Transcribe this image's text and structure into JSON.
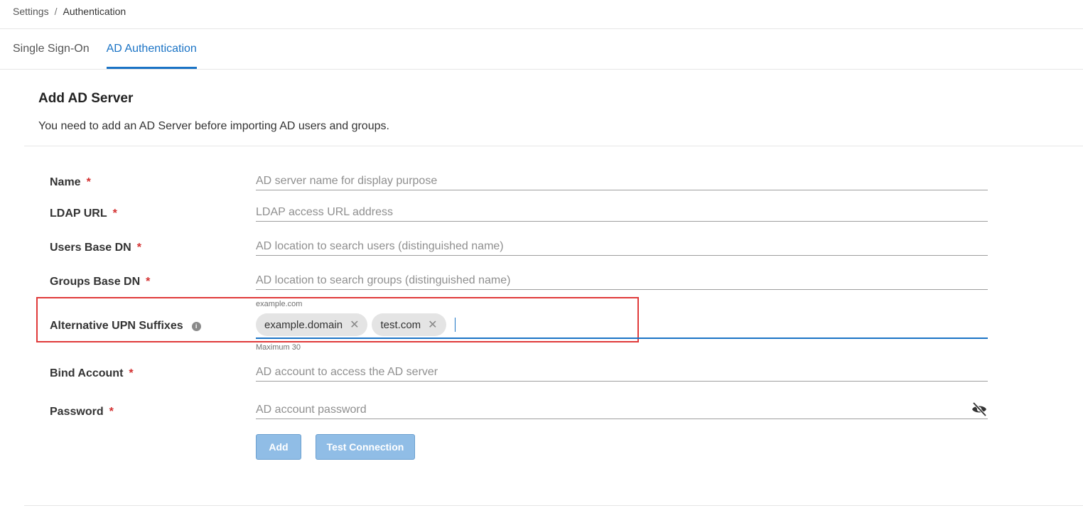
{
  "breadcrumb": {
    "root": "Settings",
    "separator": "/",
    "current": "Authentication"
  },
  "tabs": [
    {
      "label": "Single Sign-On",
      "active": false
    },
    {
      "label": "AD Authentication",
      "active": true
    }
  ],
  "section": {
    "title": "Add AD Server",
    "description": "You need to add an AD Server before importing AD users and groups."
  },
  "form": {
    "required_marker": "*",
    "name": {
      "label": "Name",
      "placeholder": "AD server name for display purpose",
      "value": ""
    },
    "ldap_url": {
      "label": "LDAP URL",
      "placeholder": "LDAP access URL address",
      "value": ""
    },
    "users_base_dn": {
      "label": "Users Base DN",
      "placeholder": "AD location to search users (distinguished name)",
      "value": ""
    },
    "groups_base_dn": {
      "label": "Groups Base DN",
      "placeholder": "AD location to search groups (distinguished name)",
      "value": ""
    },
    "upn_suffixes": {
      "label": "Alternative UPN Suffixes",
      "info_icon": "i",
      "hint": "example.com",
      "chips": [
        "example.domain",
        "test.com"
      ],
      "chip_close": "✕",
      "helper": "Maximum 30"
    },
    "bind_account": {
      "label": "Bind Account",
      "placeholder": "AD account to access the AD server",
      "value": ""
    },
    "password": {
      "label": "Password",
      "placeholder": "AD account password",
      "value": "",
      "icon": "eye-off-icon"
    }
  },
  "buttons": {
    "add": "Add",
    "test_connection": "Test Connection"
  },
  "colors": {
    "accent": "#1a73c5",
    "required": "#d32f2f",
    "button_disabled": "#90bde6",
    "highlight": "#e03a3a"
  }
}
